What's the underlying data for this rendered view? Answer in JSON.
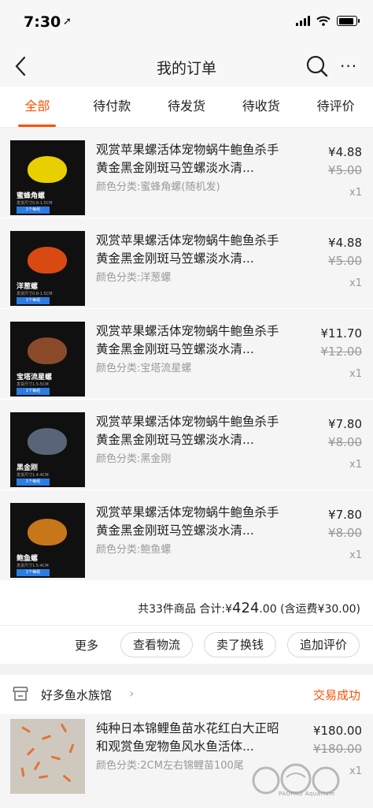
{
  "status": {
    "time": "7:30",
    "location_arrow": "➚",
    "battery_level": 0.9
  },
  "nav": {
    "title": "我的订单",
    "more": "···"
  },
  "tabs": [
    {
      "label": "全部",
      "active": true
    },
    {
      "label": "待付款",
      "active": false
    },
    {
      "label": "待发货",
      "active": false
    },
    {
      "label": "待收货",
      "active": false
    },
    {
      "label": "待评价",
      "active": false
    }
  ],
  "items": [
    {
      "title": "观赏苹果螺活体宠物蜗牛鲍鱼杀手黄金黑金刚斑马笠螺淡水清...",
      "spec": "颜色分类:蜜蜂角螺(随机发)",
      "price": "¥4.88",
      "original_price": "¥5.00",
      "qty": "x1",
      "thumb_label": "蜜蜂角螺",
      "thumb_sub": "发货尺寸0.8-1.5CM",
      "thumb_btn": "1个每组",
      "shell_color": "#e8d000"
    },
    {
      "title": "观赏苹果螺活体宠物蜗牛鲍鱼杀手黄金黑金刚斑马笠螺淡水清...",
      "spec": "颜色分类:洋葱螺",
      "price": "¥4.88",
      "original_price": "¥5.00",
      "qty": "x1",
      "thumb_label": "洋葱螺",
      "thumb_sub": "发货尺寸0.8-1.5CM",
      "thumb_btn": "1个每组",
      "shell_color": "#d84a12"
    },
    {
      "title": "观赏苹果螺活体宠物蜗牛鲍鱼杀手黄金黑金刚斑马笠螺淡水清...",
      "spec": "颜色分类:宝塔流星螺",
      "price": "¥11.70",
      "original_price": "¥12.00",
      "qty": "x1",
      "thumb_label": "宝塔流星螺",
      "thumb_sub": "发货尺寸1.5-5CM",
      "thumb_btn": "1个每组",
      "shell_color": "#8a4a2a"
    },
    {
      "title": "观赏苹果螺活体宠物蜗牛鲍鱼杀手黄金黑金刚斑马笠螺淡水清...",
      "spec": "颜色分类:黑金刚",
      "price": "¥7.80",
      "original_price": "¥8.00",
      "qty": "x1",
      "thumb_label": "黑金刚",
      "thumb_sub": "发货尺寸1.4-4CM",
      "thumb_btn": "1个每组",
      "shell_color": "#5a6478"
    },
    {
      "title": "观赏苹果螺活体宠物蜗牛鲍鱼杀手黄金黑金刚斑马笠螺淡水清...",
      "spec": "颜色分类:鲍鱼螺",
      "price": "¥7.80",
      "original_price": "¥8.00",
      "qty": "x1",
      "thumb_label": "鲍鱼螺",
      "thumb_sub": "发货尺寸1.5-4CM",
      "thumb_btn": "1个每组",
      "shell_color": "#c8761a"
    }
  ],
  "summary": {
    "prefix": "共33件商品 合计:¥",
    "amount": "424",
    "decimals": ".00",
    "shipping": " (含运费¥30.00)"
  },
  "actions": {
    "more": "更多",
    "logistics": "查看物流",
    "resell": "卖了换钱",
    "review": "追加评价"
  },
  "shop": {
    "name": "好多鱼水族馆",
    "status": "交易成功"
  },
  "item2": {
    "title": "纯种日本锦鲤鱼苗水花红白大正昭和观赏鱼宠物鱼风水鱼活体...",
    "spec": "颜色分类:2CM左右锦鲤苗100尾",
    "price": "¥180.00",
    "original_price": "¥180.00",
    "qty": "x1"
  },
  "watermark": "PAOPAO Aquarium",
  "colors": {
    "accent": "#ff5000"
  }
}
